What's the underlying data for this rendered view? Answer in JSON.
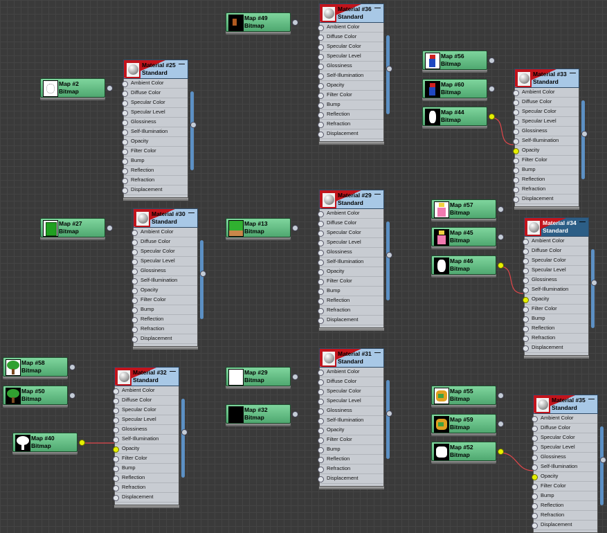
{
  "slot_labels": [
    "Ambient Color",
    "Diffuse Color",
    "Specular Color",
    "Specular Level",
    "Glossiness",
    "Self-Illumination",
    "Opacity",
    "Filter Color",
    "Bump",
    "Reflection",
    "Refraction",
    "Displacement"
  ],
  "colors": {
    "map_node": "#5cb87d",
    "material_header": "#a8c8e6",
    "selected_header": "#2c5e86",
    "wire": "#e0464a",
    "active_port": "#e6f000"
  },
  "maps": [
    {
      "name": "Map #49",
      "type": "Bitmap",
      "thumb": "mario-door-icon"
    },
    {
      "name": "Map #2",
      "type": "Bitmap",
      "thumb": "outline-icon"
    },
    {
      "name": "Map #56",
      "type": "Bitmap",
      "thumb": "mario-icon"
    },
    {
      "name": "Map #60",
      "type": "Bitmap",
      "thumb": "mario-dark-icon"
    },
    {
      "name": "Map #44",
      "type": "Bitmap",
      "thumb": "mario-mask-icon"
    },
    {
      "name": "Map #27",
      "type": "Bitmap",
      "thumb": "pipe-icon"
    },
    {
      "name": "Map #13",
      "type": "Bitmap",
      "thumb": "grass-block-icon"
    },
    {
      "name": "Map #57",
      "type": "Bitmap",
      "thumb": "peach-icon"
    },
    {
      "name": "Map #45",
      "type": "Bitmap",
      "thumb": "peach-dark-icon"
    },
    {
      "name": "Map #46",
      "type": "Bitmap",
      "thumb": "peach-mask-icon"
    },
    {
      "name": "Map #58",
      "type": "Bitmap",
      "thumb": "tree-icon"
    },
    {
      "name": "Map #50",
      "type": "Bitmap",
      "thumb": "tree-dark-icon"
    },
    {
      "name": "Map #40",
      "type": "Bitmap",
      "thumb": "tree-mask-icon"
    },
    {
      "name": "Map #29",
      "type": "Bitmap",
      "thumb": "white-icon"
    },
    {
      "name": "Map #32",
      "type": "Bitmap",
      "thumb": "black-icon"
    },
    {
      "name": "Map #55",
      "type": "Bitmap",
      "thumb": "bowser-icon"
    },
    {
      "name": "Map #59",
      "type": "Bitmap",
      "thumb": "bowser-dark-icon"
    },
    {
      "name": "Map #52",
      "type": "Bitmap",
      "thumb": "bowser-mask-icon"
    }
  ],
  "materials": [
    {
      "name": "Material #36",
      "type": "Standard",
      "opacity_linked": false
    },
    {
      "name": "Material #25",
      "type": "Standard",
      "opacity_linked": false
    },
    {
      "name": "Material #33",
      "type": "Standard",
      "opacity_linked": true
    },
    {
      "name": "Material #30",
      "type": "Standard",
      "opacity_linked": false
    },
    {
      "name": "Material #29",
      "type": "Standard",
      "opacity_linked": false
    },
    {
      "name": "Material #34",
      "type": "Standard",
      "opacity_linked": true,
      "selected": true
    },
    {
      "name": "Material #32",
      "type": "Standard",
      "opacity_linked": true
    },
    {
      "name": "Material #31",
      "type": "Standard",
      "opacity_linked": false
    },
    {
      "name": "Material #35",
      "type": "Standard",
      "opacity_linked": true
    }
  ]
}
